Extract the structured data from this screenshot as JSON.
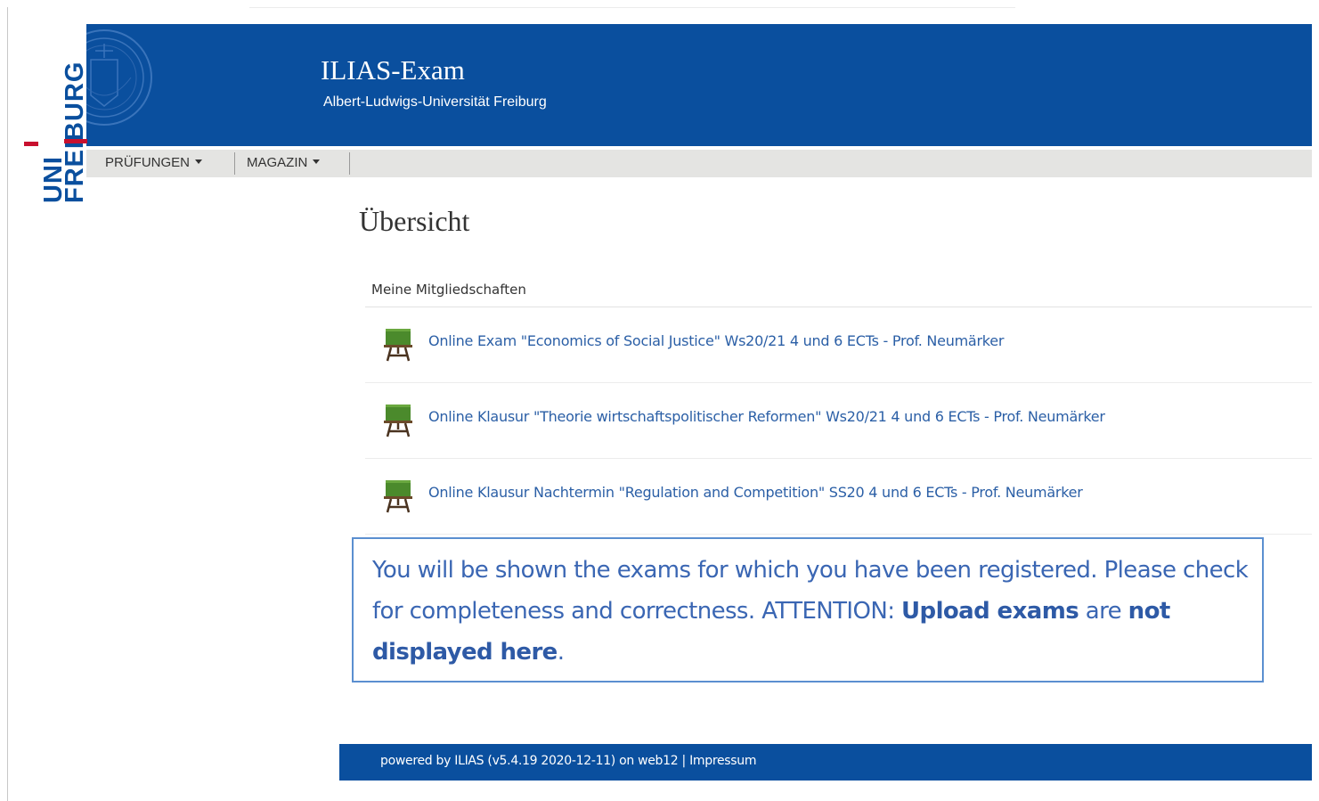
{
  "header": {
    "title": "ILIAS-Exam",
    "subtitle": "Albert-Ludwigs-Universität Freiburg",
    "logo_text": "UNI FREIBURG",
    "brand_color": "#0a4f9e"
  },
  "nav": {
    "items": [
      {
        "label": "PRÜFUNGEN",
        "icon": "caret-down-icon"
      },
      {
        "label": "MAGAZIN",
        "icon": "caret-down-icon"
      }
    ]
  },
  "main": {
    "page_title": "Übersicht",
    "section_title": "Meine Mitgliedschaften",
    "items": [
      {
        "label": "Online Exam \"Economics of Social Justice\" Ws20/21 4 und 6 ECTs - Prof. Neumärker",
        "icon": "classroom-board-icon"
      },
      {
        "label": "Online Klausur \"Theorie wirtschaftspolitischer Reformen\" Ws20/21 4 und 6 ECTs - Prof. Neumärker",
        "icon": "classroom-board-icon"
      },
      {
        "label": "Online Klausur Nachtermin \"Regulation and Competition\" SS20 4 und 6 ECTs - Prof. Neumärker",
        "icon": "classroom-board-icon"
      }
    ]
  },
  "notice": {
    "part1": "You will be shown the exams for which you have been registered. Please check for completeness and correctness. ATTENTION: ",
    "bold1": "Upload exams",
    "part2": " are ",
    "bold2": "not displayed here",
    "part3": "."
  },
  "footer": {
    "powered_by": "powered by ILIAS (v5.4.19 2020-12-11) on web12",
    "separator": " | ",
    "impressum": "Impressum"
  }
}
